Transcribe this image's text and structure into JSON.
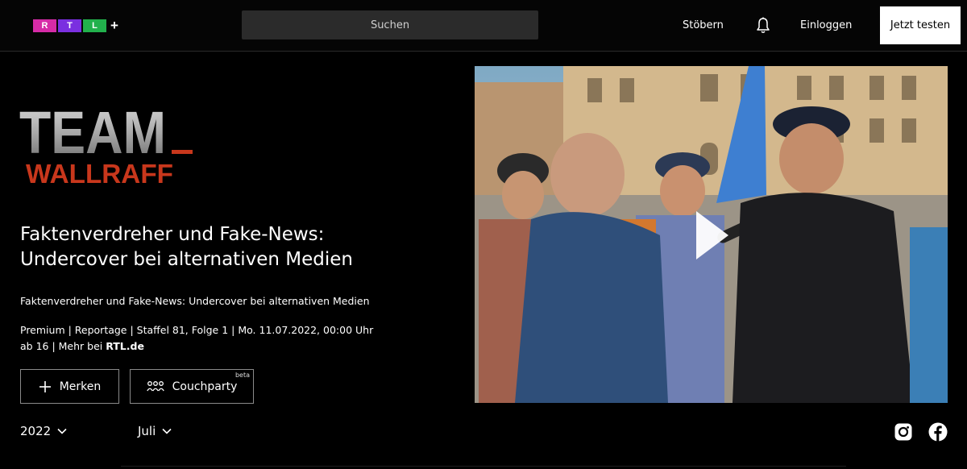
{
  "header": {
    "logo": {
      "letters": [
        "R",
        "T",
        "L"
      ],
      "plus": "+",
      "colors": [
        "#d62ba7",
        "#7a2fe0",
        "#22b14c"
      ]
    },
    "search_placeholder": "Suchen",
    "browse_label": "Stöbern",
    "bell_icon": "bell-icon",
    "login_label": "Einloggen",
    "cta_label": "Jetzt testen"
  },
  "show": {
    "logo_line1": "TEAM",
    "logo_line2": "WALLRAFF",
    "accent_color": "#c8371c"
  },
  "episode": {
    "title_line1": "Faktenverdreher und Fake-News:",
    "title_line2": "Undercover bei alternativen Medien",
    "subtitle": "Faktenverdreher und Fake-News: Undercover bei alternativen Medien",
    "meta_line1": "Premium | Reportage | Staffel 81, Folge 1 | Mo. 11.07.2022, 00:00 Uhr",
    "meta_line2_prefix": "ab 16 | Mehr bei ",
    "meta_line2_link": "RTL.de"
  },
  "actions": {
    "watchlist_label": "Merken",
    "couchparty_label": "Couchparty",
    "couchparty_badge": "beta"
  },
  "filters": {
    "year": "2022",
    "month": "Juli"
  },
  "social": [
    "instagram-icon",
    "facebook-icon"
  ]
}
